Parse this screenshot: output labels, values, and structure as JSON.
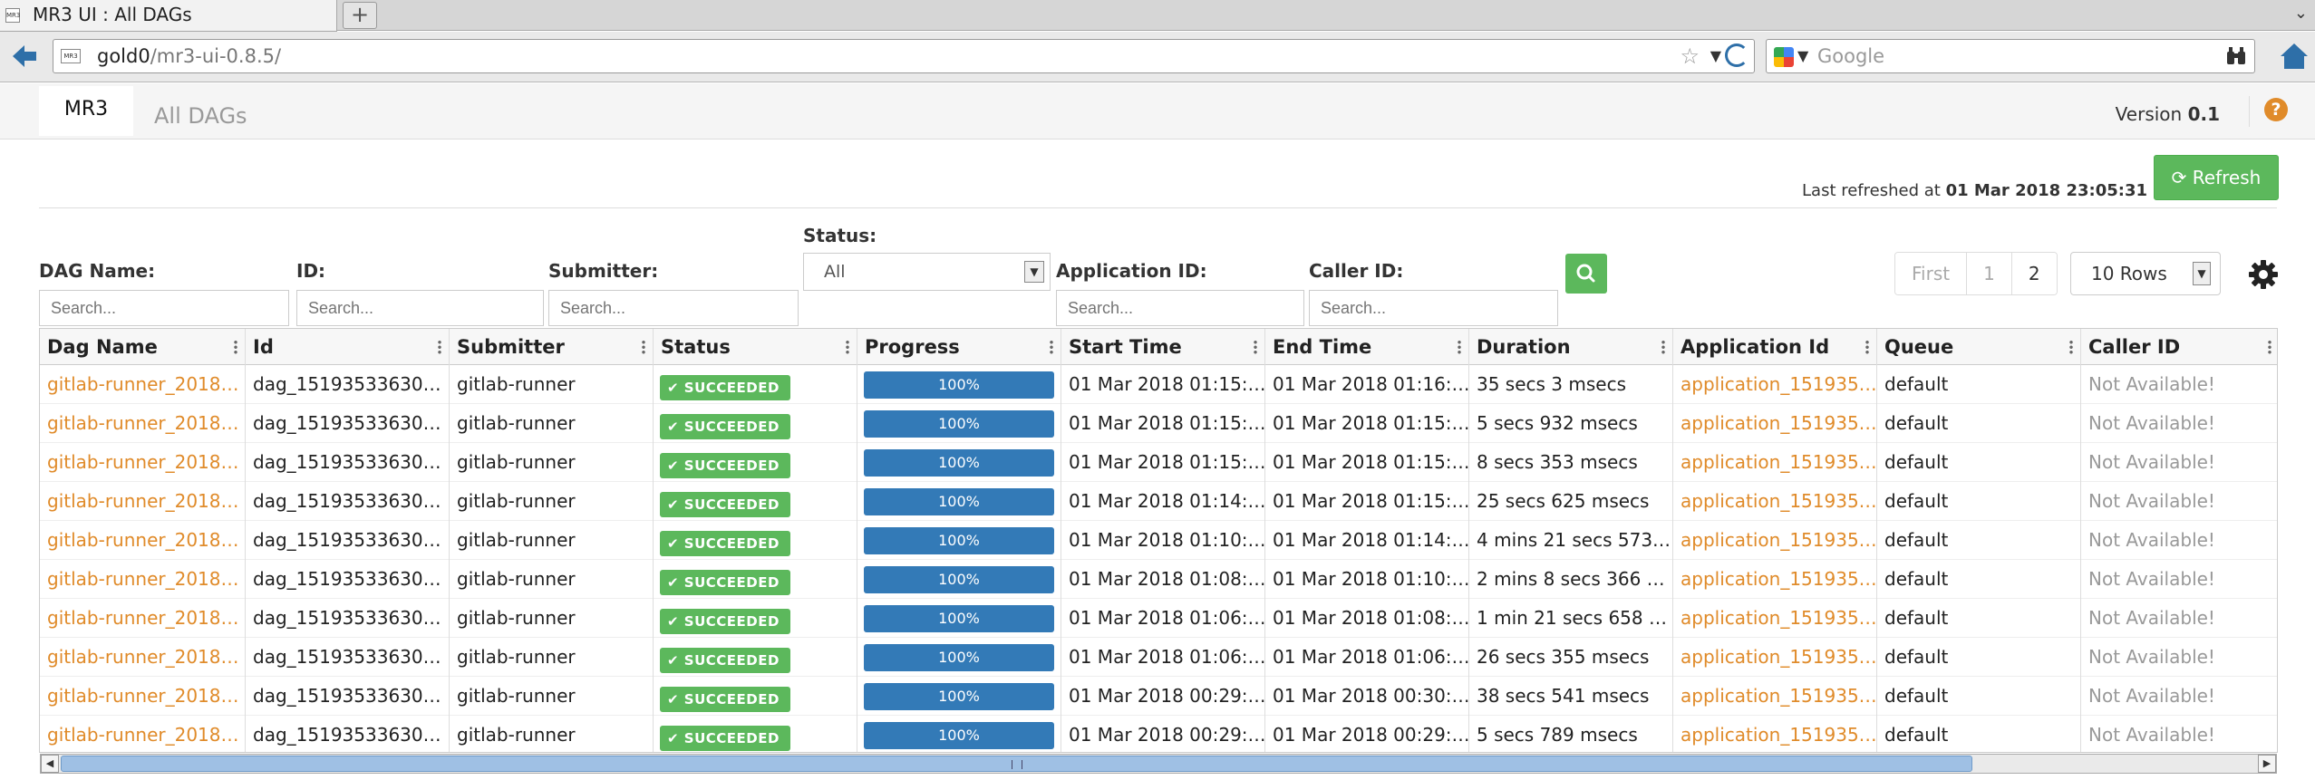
{
  "browser": {
    "tab_title": "MR3 UI : All DAGs",
    "favicon_text": "MR3",
    "url_host": "gold0",
    "url_path": "/mr3-ui-0.8.5/",
    "search_placeholder": "Google"
  },
  "header": {
    "brand": "MR3",
    "page_title": "All DAGs",
    "version_label": "Version",
    "version_value": "0.1"
  },
  "refresh": {
    "last_refreshed_label": "Last refreshed at",
    "last_refreshed_value": "01 Mar 2018 23:05:31",
    "button_label": "Refresh"
  },
  "filters": {
    "dag_name_label": "DAG Name:",
    "id_label": "ID:",
    "submitter_label": "Submitter:",
    "status_label": "Status:",
    "status_value": "All",
    "application_id_label": "Application ID:",
    "caller_id_label": "Caller ID:",
    "search_placeholder": "Search..."
  },
  "pagination": {
    "first": "First",
    "pages": [
      "1",
      "2"
    ],
    "rows_per_page": "10 Rows"
  },
  "table": {
    "columns": [
      "Dag Name",
      "Id",
      "Submitter",
      "Status",
      "Progress",
      "Start Time",
      "End Time",
      "Duration",
      "Application Id",
      "Queue",
      "Caller ID"
    ],
    "rows": [
      {
        "dag_name": "gitlab-runner_2018…",
        "id": "dag_15193533630…",
        "submitter": "gitlab-runner",
        "status": "SUCCEEDED",
        "progress": 1.0,
        "progress_label": "100%",
        "start": "01 Mar 2018 01:15:…",
        "end": "01 Mar 2018 01:16:…",
        "duration": "35 secs 3 msecs",
        "app_id": "application_151935…",
        "queue": "default",
        "caller_id": "Not Available!"
      },
      {
        "dag_name": "gitlab-runner_2018…",
        "id": "dag_15193533630…",
        "submitter": "gitlab-runner",
        "status": "SUCCEEDED",
        "progress": 1.0,
        "progress_label": "100%",
        "start": "01 Mar 2018 01:15:…",
        "end": "01 Mar 2018 01:15:…",
        "duration": "5 secs 932 msecs",
        "app_id": "application_151935…",
        "queue": "default",
        "caller_id": "Not Available!"
      },
      {
        "dag_name": "gitlab-runner_2018…",
        "id": "dag_15193533630…",
        "submitter": "gitlab-runner",
        "status": "SUCCEEDED",
        "progress": 1.0,
        "progress_label": "100%",
        "start": "01 Mar 2018 01:15:…",
        "end": "01 Mar 2018 01:15:…",
        "duration": "8 secs 353 msecs",
        "app_id": "application_151935…",
        "queue": "default",
        "caller_id": "Not Available!"
      },
      {
        "dag_name": "gitlab-runner_2018…",
        "id": "dag_15193533630…",
        "submitter": "gitlab-runner",
        "status": "SUCCEEDED",
        "progress": 1.0,
        "progress_label": "100%",
        "start": "01 Mar 2018 01:14:…",
        "end": "01 Mar 2018 01:15:…",
        "duration": "25 secs 625 msecs",
        "app_id": "application_151935…",
        "queue": "default",
        "caller_id": "Not Available!"
      },
      {
        "dag_name": "gitlab-runner_2018…",
        "id": "dag_15193533630…",
        "submitter": "gitlab-runner",
        "status": "SUCCEEDED",
        "progress": 1.0,
        "progress_label": "100%",
        "start": "01 Mar 2018 01:10:…",
        "end": "01 Mar 2018 01:14:…",
        "duration": "4 mins 21 secs 573…",
        "app_id": "application_151935…",
        "queue": "default",
        "caller_id": "Not Available!"
      },
      {
        "dag_name": "gitlab-runner_2018…",
        "id": "dag_15193533630…",
        "submitter": "gitlab-runner",
        "status": "SUCCEEDED",
        "progress": 1.0,
        "progress_label": "100%",
        "start": "01 Mar 2018 01:08:…",
        "end": "01 Mar 2018 01:10:…",
        "duration": "2 mins 8 secs 366 …",
        "app_id": "application_151935…",
        "queue": "default",
        "caller_id": "Not Available!"
      },
      {
        "dag_name": "gitlab-runner_2018…",
        "id": "dag_15193533630…",
        "submitter": "gitlab-runner",
        "status": "SUCCEEDED",
        "progress": 1.0,
        "progress_label": "100%",
        "start": "01 Mar 2018 01:06:…",
        "end": "01 Mar 2018 01:08:…",
        "duration": "1 min 21 secs 658 …",
        "app_id": "application_151935…",
        "queue": "default",
        "caller_id": "Not Available!"
      },
      {
        "dag_name": "gitlab-runner_2018…",
        "id": "dag_15193533630…",
        "submitter": "gitlab-runner",
        "status": "SUCCEEDED",
        "progress": 1.0,
        "progress_label": "100%",
        "start": "01 Mar 2018 01:06:…",
        "end": "01 Mar 2018 01:06:…",
        "duration": "26 secs 355 msecs",
        "app_id": "application_151935…",
        "queue": "default",
        "caller_id": "Not Available!"
      },
      {
        "dag_name": "gitlab-runner_2018…",
        "id": "dag_15193533630…",
        "submitter": "gitlab-runner",
        "status": "SUCCEEDED",
        "progress": 1.0,
        "progress_label": "100%",
        "start": "01 Mar 2018 00:29:…",
        "end": "01 Mar 2018 00:30:…",
        "duration": "38 secs 541 msecs",
        "app_id": "application_151935…",
        "queue": "default",
        "caller_id": "Not Available!"
      },
      {
        "dag_name": "gitlab-runner_2018…",
        "id": "dag_15193533630…",
        "submitter": "gitlab-runner",
        "status": "SUCCEEDED",
        "progress": 1.0,
        "progress_label": "100%",
        "start": "01 Mar 2018 00:29:…",
        "end": "01 Mar 2018 00:29:…",
        "duration": "5 secs 789 msecs",
        "app_id": "application_151935…",
        "queue": "default",
        "caller_id": "Not Available!"
      }
    ]
  },
  "scrollbar": {
    "visible_fraction": 0.87
  },
  "colors": {
    "accent_link": "#e08b2a",
    "success": "#5cb85c",
    "progress": "#337ab7"
  }
}
